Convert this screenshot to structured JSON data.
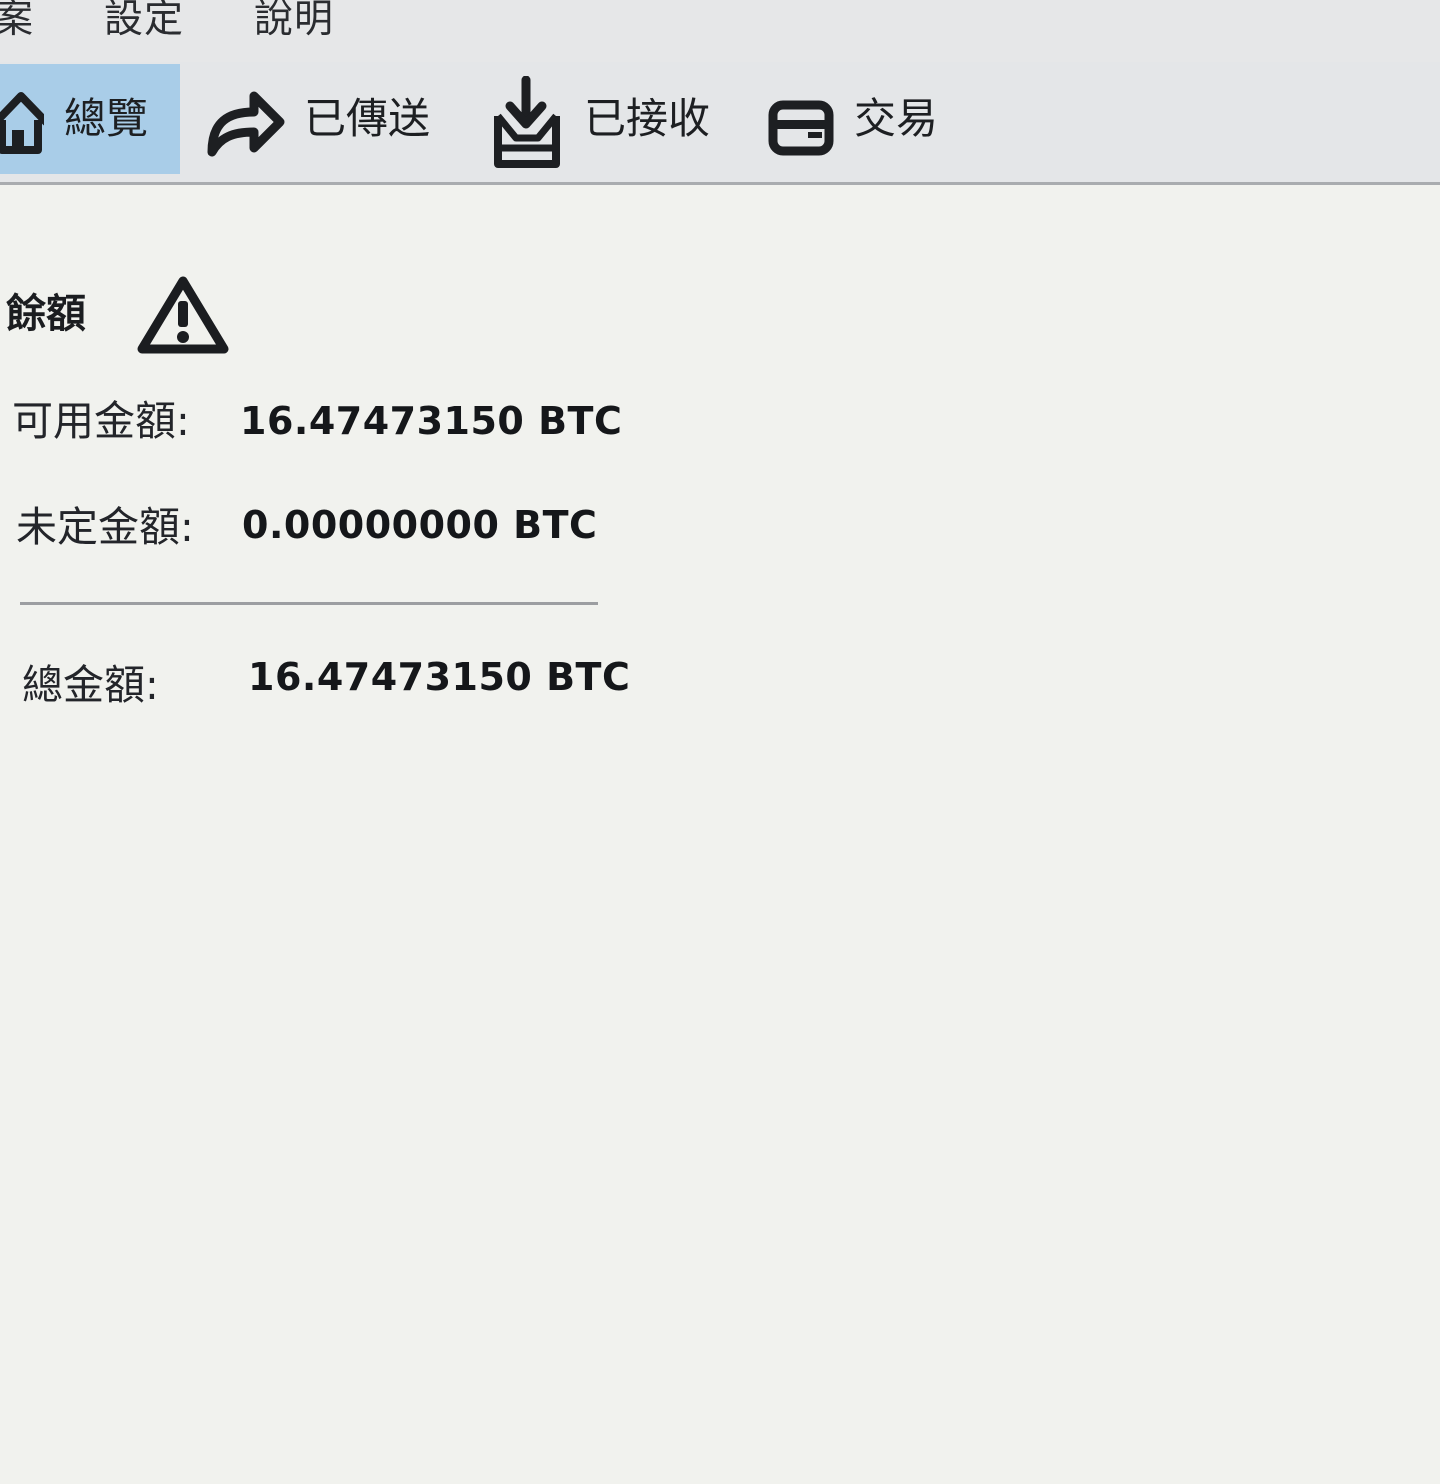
{
  "menu": {
    "items": [
      {
        "label": "案"
      },
      {
        "label": "設定"
      },
      {
        "label": "說明"
      }
    ]
  },
  "toolbar": {
    "tabs": [
      {
        "label": "總覽",
        "icon": "home-icon",
        "active": true
      },
      {
        "label": "已傳送",
        "icon": "send-arrow-icon",
        "active": false
      },
      {
        "label": "已接收",
        "icon": "inbox-download-icon",
        "active": false
      },
      {
        "label": "交易",
        "icon": "card-icon",
        "active": false
      }
    ]
  },
  "balance": {
    "title": "餘額",
    "warning_icon": "warning-triangle-icon",
    "available": {
      "label": "可用金額:",
      "value": "16.47473150 BTC"
    },
    "pending": {
      "label": "未定金額:",
      "value": "0.00000000 BTC"
    },
    "total": {
      "label": "總金額:",
      "value": "16.47473150 BTC"
    }
  },
  "colors": {
    "active_tab": "#a9cde8",
    "background": "#f1f2ee",
    "toolbar": "#e4e6e8"
  }
}
